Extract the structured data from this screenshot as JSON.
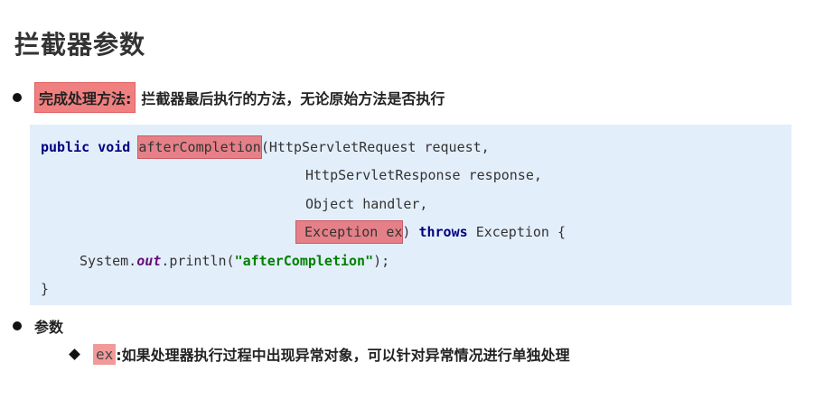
{
  "title": "拦截器参数",
  "bullet1": {
    "label": "完成处理方法:",
    "text": "拦截器最后执行的方法，无论原始方法是否执行"
  },
  "code": {
    "line1_kw": "public void",
    "line1_method": "afterCompletion",
    "line1_rest": "(HttpServletRequest request,",
    "line2": "HttpServletResponse response,",
    "line3": "Object handler,",
    "line4_param": "Exception ex",
    "line4_paren": ")",
    "line4_kw": "throws",
    "line4_rest": "Exception {",
    "line5_pre": "System.",
    "line5_field": "out",
    "line5_mid": ".println(",
    "line5_str": "\"afterCompletion\"",
    "line5_post": ");",
    "line6": "}"
  },
  "bullet2": {
    "label": "参数"
  },
  "sub_bullet": {
    "code_label": "ex",
    "text": ":如果处理器执行过程中出现异常对象，可以针对异常情况进行单独处理"
  }
}
